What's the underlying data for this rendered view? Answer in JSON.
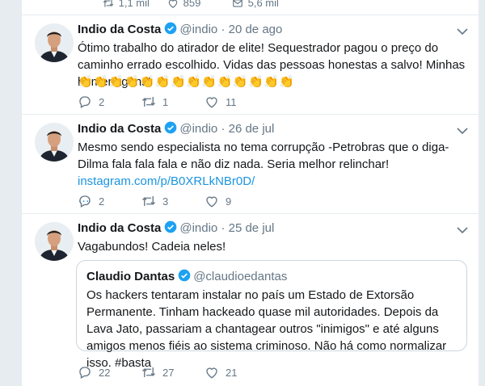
{
  "prev_tweet": {
    "replies": "",
    "retweets": "1,1 mil",
    "likes": "859",
    "dm": "5,6 mil"
  },
  "colors": {
    "link": "#1b95e0",
    "muted": "#657786",
    "verified": "#1da1f2"
  },
  "tweets": [
    {
      "name": "Indio da Costa",
      "handle": "@indio",
      "sep": "·",
      "date": "20 de ago",
      "text": "Ótimo trabalho do atirador de elite! Sequestrador pagou o preço do caminho errado escolhido. Vidas das pessoas honestas a salvo! Minhas homenagens!",
      "claps": "👏👏👏👏👏👏👏👏👏👏👏👏👏👏",
      "replies": "2",
      "retweets": "1",
      "likes": "11"
    },
    {
      "name": "Indio da Costa",
      "handle": "@indio",
      "sep": "·",
      "date": "26 de jul",
      "text": "Mesmo sendo especialista no tema corrupção -Petrobras que o diga- Dilma fala fala fala e não diz nada. Seria melhor relinchar! ",
      "link": "instagram.com/p/B0XRLkNBr0D/",
      "ellipsis": "…",
      "replies": "2",
      "retweets": "3",
      "likes": "9"
    },
    {
      "name": "Indio da Costa",
      "handle": "@indio",
      "sep": "·",
      "date": "25 de jul",
      "text": "Vagabundos! Cadeia neles!",
      "quote": {
        "name": "Claudio Dantas",
        "handle": "@claudioedantas",
        "text": "Os hackers tentaram instalar no país um Estado de Extorsão Permanente. Tinham hackeado quase mil autoridades. Depois da Lava Jato, passariam a chantagear outros \"inimigos\" e até alguns amigos menos fiéis ao sistema criminoso. Não há como normalizar isso. #basta"
      },
      "replies": "22",
      "retweets": "27",
      "likes": "21"
    }
  ]
}
